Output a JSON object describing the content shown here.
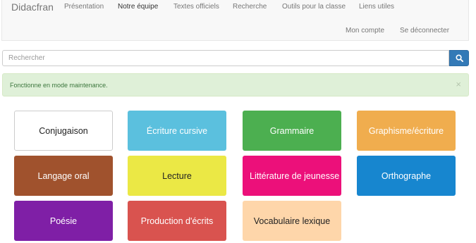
{
  "navbar": {
    "brand": "Didacfran",
    "items": [
      {
        "label": "Présentation"
      },
      {
        "label": "Notre équipe"
      },
      {
        "label": "Textes officiels"
      },
      {
        "label": "Recherche"
      },
      {
        "label": "Outils pour la classe"
      },
      {
        "label": "Liens utiles"
      }
    ],
    "account": "Mon compte",
    "logout": "Se déconnecter"
  },
  "search": {
    "placeholder": "Rechercher",
    "button_icon": "search-icon"
  },
  "alert": {
    "text": "Fonctionne en mode maintenance.",
    "close": "×"
  },
  "tiles": [
    {
      "label": "Conjugaison",
      "color": "#ffffff",
      "text_color": "#222222"
    },
    {
      "label": "Écriture cursive",
      "color": "#5bc0de",
      "text_color": "#ffffff"
    },
    {
      "label": "Grammaire",
      "color": "#4caf50",
      "text_color": "#ffffff"
    },
    {
      "label": "Graphisme/écriture",
      "color": "#f0ad4e",
      "text_color": "#ffffff"
    },
    {
      "label": "Langage oral",
      "color": "#a0522d",
      "text_color": "#ffffff"
    },
    {
      "label": "Lecture",
      "color": "#ebe845",
      "text_color": "#222222"
    },
    {
      "label": "Littérature de jeunesse",
      "color": "#ec107a",
      "text_color": "#ffffff"
    },
    {
      "label": "Orthographe",
      "color": "#1786cf",
      "text_color": "#ffffff"
    },
    {
      "label": "Poésie",
      "color": "#7f1fa6",
      "text_color": "#ffffff"
    },
    {
      "label": "Production d'écrits",
      "color": "#d9534f",
      "text_color": "#ffffff"
    },
    {
      "label": "Vocabulaire lexique",
      "color": "#fed6aa",
      "text_color": "#222222"
    }
  ]
}
